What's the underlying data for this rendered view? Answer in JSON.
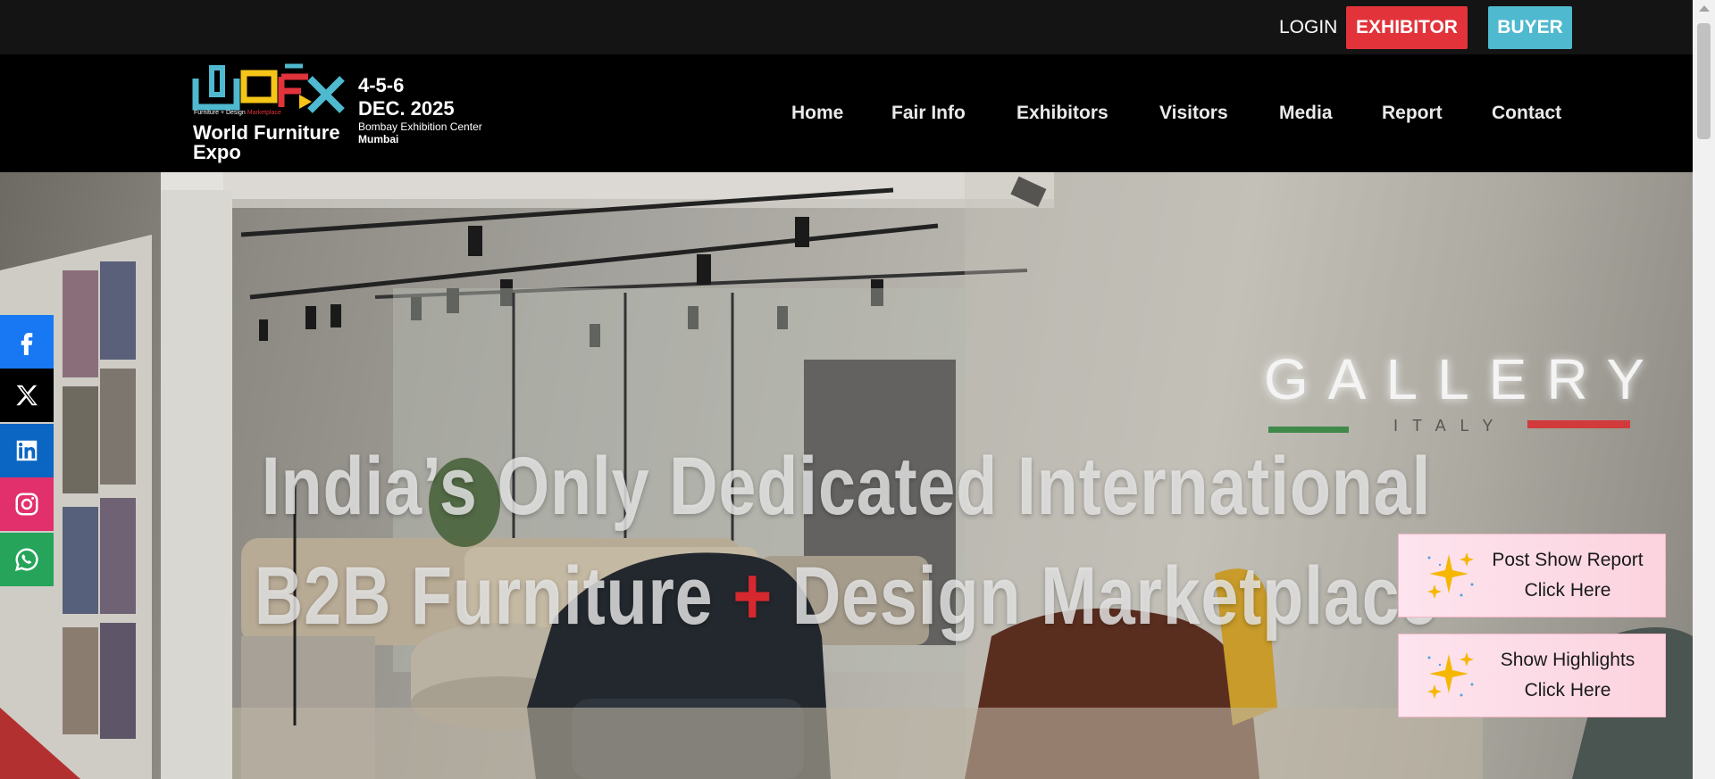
{
  "topbar": {
    "login_label": "LOGIN",
    "exhibitor_label": "EXHIBITOR",
    "buyer_label": "BUYER"
  },
  "brand": {
    "tagline_left": "Furniture + Design",
    "tagline_right": "Marketplace",
    "name": "World Furniture Expo",
    "dates": "4-5-6",
    "month": "DEC. 2025",
    "venue": "Bombay Exhibition Center",
    "city": "Mumbai"
  },
  "nav": {
    "items": [
      {
        "label": "Home"
      },
      {
        "label": "Fair Info"
      },
      {
        "label": "Exhibitors"
      },
      {
        "label": "Visitors"
      },
      {
        "label": "Media"
      },
      {
        "label": "Report"
      },
      {
        "label": "Contact"
      }
    ]
  },
  "hero": {
    "line1": "India’s Only Dedicated International",
    "line2_a": "B2B Furniture",
    "line2_plus": "+",
    "line2_b": "Design Marketplace",
    "sign_main": "GALLERY",
    "sign_sub": "ITALY"
  },
  "social": [
    {
      "icon": "facebook-icon"
    },
    {
      "icon": "x-icon"
    },
    {
      "icon": "linkedin-icon"
    },
    {
      "icon": "instagram-icon"
    },
    {
      "icon": "whatsapp-icon"
    }
  ],
  "cards": {
    "report_line1": "Post Show Report",
    "report_line2": "Click Here",
    "highlights_line1": "Show Highlights",
    "highlights_line2": "Click Here"
  },
  "colors": {
    "accent_red": "#e2333b",
    "accent_cyan": "#4fb9cf",
    "facebook": "#1877f2",
    "linkedin": "#0a66c2",
    "instagram": "#e1306c",
    "whatsapp": "#25a45a"
  }
}
